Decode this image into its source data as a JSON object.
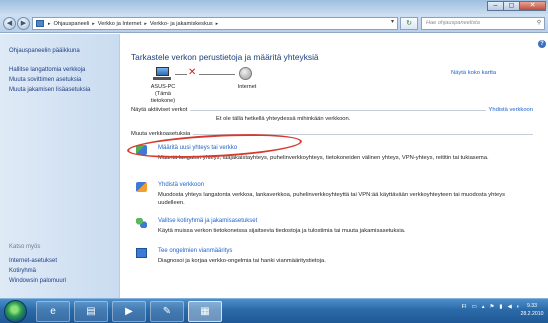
{
  "window": {
    "buttons": [
      "–",
      "◻",
      "✕"
    ]
  },
  "address": {
    "crumbs": [
      "Ohjauspaneeli",
      "Verkko ja Internet",
      "Verkko- ja jakamiskeskus"
    ],
    "search_placeholder": "Hae ohjauspaneelista"
  },
  "sidebar": {
    "home": "Ohjauspaneelin pääikkuna",
    "tasks": [
      "Hallitse langattomia verkkoja",
      "Muuta sovittimen asetuksia",
      "Muuta jakamisen lisäasetuksia"
    ],
    "see_also_title": "Katso myös",
    "see_also": [
      "Internet-asetukset",
      "Kotiryhmä",
      "Windowsin palomuuri"
    ]
  },
  "main": {
    "heading": "Tarkastele verkon perustietoja ja määritä yhteyksiä",
    "full_map_link": "Näytä koko kartta",
    "computer_name": "ASUS-PC",
    "computer_sub": "(Tämä tietokone)",
    "internet_label": "Internet",
    "active_networks_label": "Näytä aktiiviset verkot",
    "connect_link": "Yhdistä verkkoon",
    "not_connected": "Et ole tällä hetkellä yhteydessä mihinkään verkkoon.",
    "change_settings_label": "Muuta verkkoasetuksia",
    "tasks": [
      {
        "title": "Määritä uusi yhteys tai verkko",
        "desc": "Määritä langaton yhteys, laajakaistayhteys, puhelinverkkoyhteys, tietokoneiden välinen yhteys, VPN-yhteys, reititin tai tukiasema.",
        "icon": "new-connection-icon"
      },
      {
        "title": "Yhdistä verkkoon",
        "desc": "Muodosta yhteys langatonta verkkoa, lankaverkkoa, puhelinverkkoyhteyttä tai VPN:ää käyttävään verkkoyhteyteen tai muodosta yhteys uudelleen.",
        "icon": "connect-network-icon"
      },
      {
        "title": "Valitse kotiryhmä ja jakamisasetukset",
        "desc": "Käytä muissa verkon tietokoneissa sijaitsevia tiedostoja ja tulostimia tai muuta jakamisasetuksia.",
        "icon": "homegroup-icon"
      },
      {
        "title": "Tee ongelmien vianmääritys",
        "desc": "Diagnosoi ja korjaa verkko-ongelmia tai hanki vianmääritystietoja.",
        "icon": "troubleshoot-icon"
      }
    ]
  },
  "taskbar": {
    "tray_lang": "FI",
    "clock_time": "9.33",
    "clock_date": "28.2.2010"
  },
  "colors": {
    "link": "#1f64c8",
    "heading": "#1c3f7a",
    "highlight": "#d63a2c"
  }
}
